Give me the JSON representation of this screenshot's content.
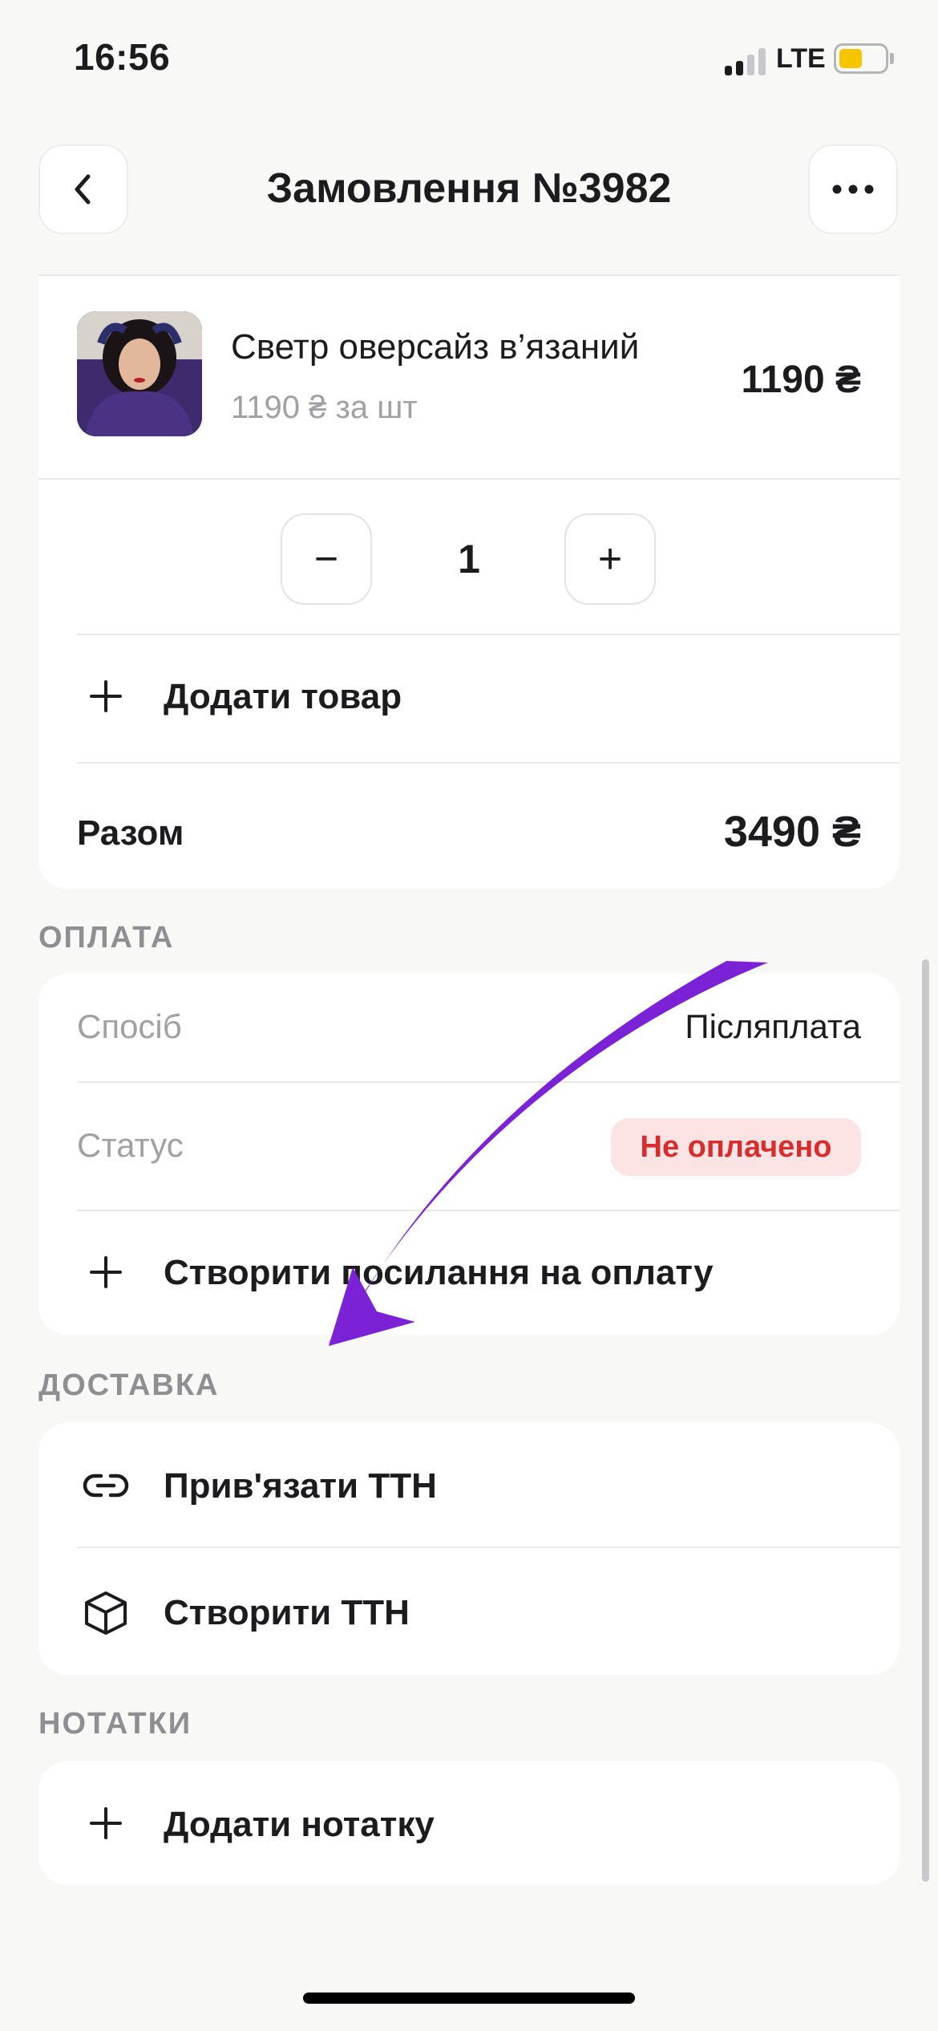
{
  "status_bar": {
    "time": "16:56",
    "network": "LTE",
    "icons": [
      "signal-icon",
      "battery-icon"
    ],
    "battery_color": "#f6c500"
  },
  "header": {
    "title": "Замовлення №3982",
    "back_icon": "chevron-left-icon",
    "more_icon": "more-horizontal-icon"
  },
  "order_items": {
    "product": {
      "name": "Светр оверсайз в’язаний",
      "unit_price": "1190 ₴ за шт",
      "price": "1190 ₴"
    },
    "quantity": "1",
    "decrement_label": "−",
    "increment_label": "+",
    "add_item_label": "Додати товар",
    "total_label": "Разом",
    "total_value": "3490 ₴"
  },
  "payment": {
    "section_title": "ОПЛАТА",
    "method_label": "Спосіб",
    "method_value": "Післяплата",
    "status_label": "Статус",
    "status_value": "Не оплачено",
    "status_color": "#d92d2d",
    "create_link_label": "Створити посилання на оплату"
  },
  "delivery": {
    "section_title": "ДОСТАВКА",
    "link_ttn_label": "Прив'язати ТТН",
    "create_ttn_label": "Створити ТТН",
    "link_icon": "link-icon",
    "create_icon": "package-icon"
  },
  "notes": {
    "section_title": "НОТАТКИ",
    "add_note_label": "Додати нотатку"
  },
  "annotation": {
    "arrow_color": "#7b22d6"
  }
}
